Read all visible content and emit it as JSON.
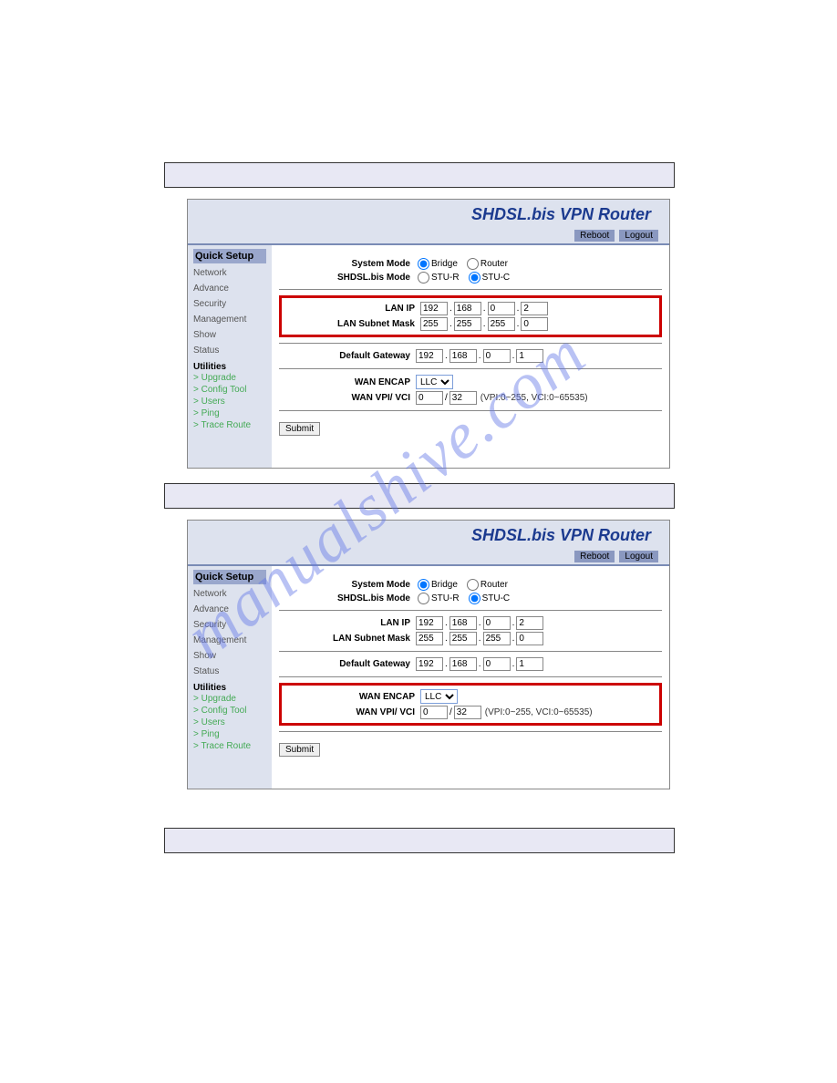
{
  "watermark": "manualshive.com",
  "router_title": "SHDSL.bis VPN Router",
  "header_buttons": {
    "reboot": "Reboot",
    "logout": "Logout"
  },
  "sidebar": {
    "active": "Quick Setup",
    "items": [
      "Network",
      "Advance",
      "Security",
      "Management",
      "Show",
      "Status"
    ],
    "util_head": "Utilities",
    "utils": [
      "> Upgrade",
      "> Config Tool",
      "> Users",
      "> Ping",
      "> Trace Route"
    ]
  },
  "form": {
    "system_mode_label": "System Mode",
    "system_mode_opt1": "Bridge",
    "system_mode_opt2": "Router",
    "shdsl_mode_label": "SHDSL.bis Mode",
    "shdsl_opt1": "STU-R",
    "shdsl_opt2": "STU-C",
    "lan_ip_label": "LAN IP",
    "lan_ip": [
      "192",
      "168",
      "0",
      "2"
    ],
    "subnet_label": "LAN Subnet Mask",
    "subnet": [
      "255",
      "255",
      "255",
      "0"
    ],
    "gateway_label": "Default Gateway",
    "gateway": [
      "192",
      "168",
      "0",
      "1"
    ],
    "encap_label": "WAN ENCAP",
    "encap_value": "LLC",
    "vpivci_label": "WAN VPI/ VCI",
    "vpi": "0",
    "vci": "32",
    "vpivci_note": "(VPI:0~255, VCI:0~65535)",
    "submit": "Submit"
  }
}
